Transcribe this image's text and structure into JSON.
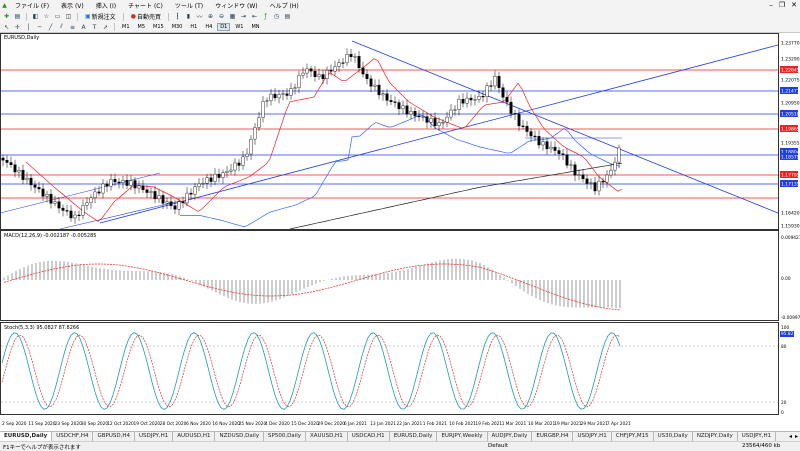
{
  "menu": [
    "ファイル (F)",
    "表示 (V)",
    "挿入 (I)",
    "チャート (C)",
    "ツール (T)",
    "ウィンドウ (W)",
    "ヘルプ (H)"
  ],
  "toolbar": {
    "new_order_label": "新規注文",
    "auto_trade_label": "自動売買"
  },
  "timeframes": [
    "M1",
    "M5",
    "M15",
    "M30",
    "H1",
    "H4",
    "D1",
    "W1",
    "MN"
  ],
  "active_timeframe": "D1",
  "chart": {
    "symbol_label": "EURUSD,Daily",
    "price_labels": [
      "1.23770",
      "1.23290",
      "1.22645",
      "1.22075",
      "1.21471",
      "1.20950",
      "1.20510",
      "1.19865",
      "1.19355",
      "1.18804",
      "1.18579",
      "1.17795",
      "1.17135",
      "1.16420",
      "1.15930"
    ],
    "date_labels": [
      "2 Sep 2020",
      "11 Sep 2020",
      "23 Sep 2020",
      "30 Sep 2020",
      "12 Oct 2020",
      "19 Oct 2020",
      "28 Oct 2020",
      "6 Nov 2020",
      "16 Nov 2020",
      "25 Nov 2020",
      "4 Dec 2020",
      "15 Dec 2020",
      "29 Dec 2020",
      "6 Jan 2021",
      "13 Jan 2021",
      "22 Jan 2021",
      "1 Feb 2021",
      "10 Feb 2021",
      "19 Feb 2021",
      "1 Mar 2021",
      "10 Mar 2021",
      "19 Mar 2021",
      "29 Mar 2021",
      "7 Apr 2021"
    ]
  },
  "macd": {
    "label": "MACD(12,26,9) -0.002187 -0.005285",
    "scale_labels": [
      "0.009427",
      "0.00",
      "-0.009975"
    ]
  },
  "stoch": {
    "label": "Stoch(5,3,3) 95.0827 87.8266",
    "scale_labels": [
      "100",
      "95.82",
      "80",
      "20",
      "0"
    ]
  },
  "tabs": [
    "EURUSD,Daily",
    "USDCHF,H4",
    "GBPUSD,H4",
    "USDJPY,H1",
    "AUDUSD,H1",
    "NZDUSD,Daily",
    "SP500,Daily",
    "XAUUSD,H1",
    "USDCAD,H1",
    "EURUSD,Daily",
    "EURJPY,Weekly",
    "AUDJPY,Daily",
    "EURGBP,H4",
    "USDJPY,H1",
    "CHFJPY,M15",
    "US30,Daily",
    "NZDJPY,Daily",
    "USDJPY,H1"
  ],
  "active_tab": 0,
  "status": {
    "help_text": "F1キーでヘルプが表示されます",
    "profile": "Default",
    "traffic": "23564/460 kb"
  },
  "colors": {
    "red_line": "#ee2222",
    "blue_line": "#1f3fe0",
    "ma_blue": "#3366ff",
    "ma_dark": "#222222",
    "stoch_main": "#1aa0a0",
    "stoch_signal": "#e03030"
  },
  "icons": [
    "new-chart-icon",
    "profiles-icon",
    "market-watch-icon",
    "navigator-icon",
    "terminal-icon",
    "tester-icon",
    "zoom-in-icon",
    "zoom-out-icon",
    "cursor-icon",
    "crosshair-icon",
    "vline-icon",
    "hline-icon",
    "trendline-icon",
    "channel-icon",
    "fibo-icon",
    "text-icon",
    "label-icon",
    "period-icon",
    "template-icon"
  ]
}
